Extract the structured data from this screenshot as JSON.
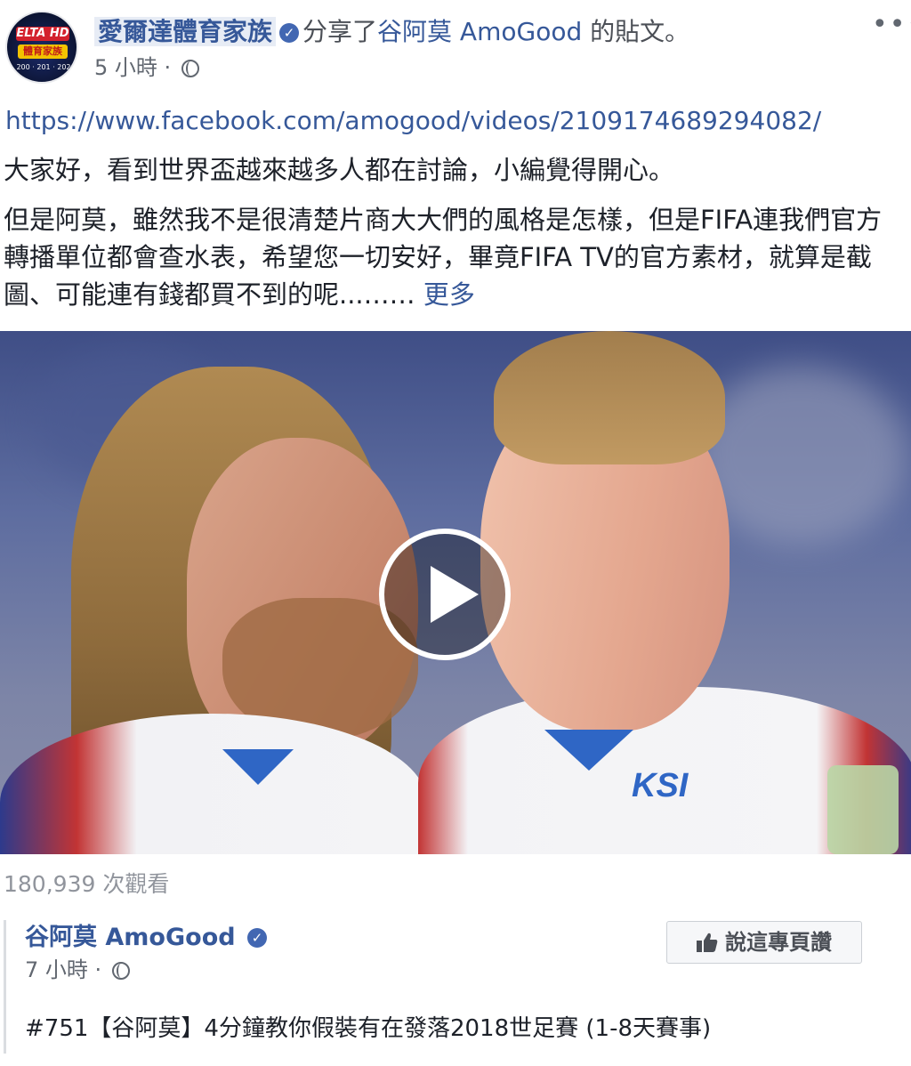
{
  "header": {
    "page_name": "愛爾達體育家族",
    "shared_text": "分享了",
    "shared_page": "谷阿莫 AmoGood",
    "post_suffix": " 的貼文。",
    "timestamp": "5 小時",
    "separator": "·",
    "more_options": "•••"
  },
  "avatar": {
    "line1": "ELTA HD",
    "line2": "體育家族",
    "line3": "200 · 201 · 202"
  },
  "post": {
    "link": "https://www.facebook.com/amogood/videos/2109174689294082/",
    "paragraph1": "大家好，看到世界盃越來越多人都在討論，小編覺得開心。",
    "paragraph2": "但是阿莫，雖然我不是很清楚片商大大們的風格是怎樣，但是FIFA連我們官方轉播單位都會查水表，希望您一切安好，畢竟FIFA TV的官方素材，就算是截圖、可能連有錢都買不到的呢...……",
    "see_more": "更多"
  },
  "video": {
    "shirt_logo": "KSI",
    "view_count": "180,939 次觀看"
  },
  "shared_post": {
    "author": "谷阿莫 AmoGood",
    "timestamp": "7 小時",
    "separator": "·",
    "like_button": "說這專頁讚",
    "title": "#751【谷阿莫】4分鐘教你假裝有在發落2018世足賽 (1-8天賽事)"
  },
  "colors": {
    "link": "#365899",
    "text": "#1d2129",
    "muted": "#616770",
    "verified": "#4267b2"
  }
}
